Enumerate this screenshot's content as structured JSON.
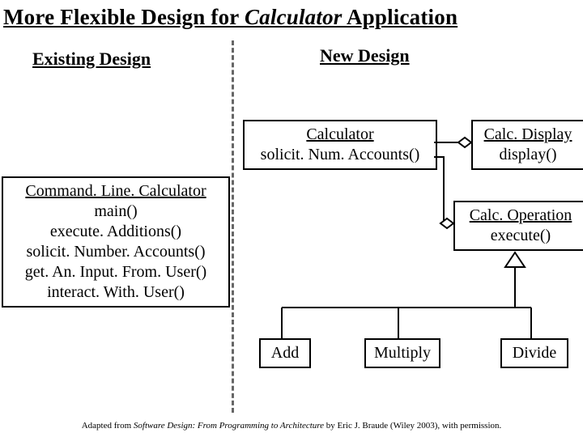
{
  "title": {
    "pre": "More Flexible Design for ",
    "ital": "Calculator",
    "post": " Application"
  },
  "headings": {
    "existing": "Existing Design",
    "new": "New Design"
  },
  "boxes": {
    "cmdline": {
      "name": "Command. Line. Calculator",
      "ops": [
        "main()",
        "execute. Additions()",
        "solicit. Number. Accounts()",
        "get. An. Input. From. User()",
        "interact. With. User()"
      ]
    },
    "calculator": {
      "name": "Calculator",
      "ops": [
        "solicit. Num. Accounts()"
      ]
    },
    "calcdisplay": {
      "name": "Calc. Display",
      "ops": [
        "display()"
      ]
    },
    "calcoperation": {
      "name": "Calc. Operation",
      "ops": [
        "execute()"
      ]
    },
    "add": {
      "name": "Add"
    },
    "multiply": {
      "name": "Multiply"
    },
    "divide": {
      "name": "Divide"
    }
  },
  "footer": {
    "pre": "Adapted from ",
    "book": "Software Design: From Programming to Architecture",
    "post": " by Eric J. Braude (Wiley 2003), with permission."
  }
}
